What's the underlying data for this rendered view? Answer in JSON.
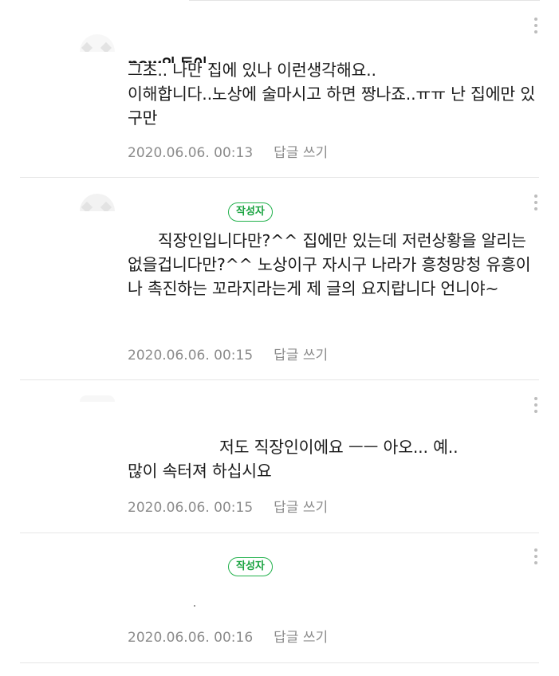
{
  "comments": [
    {
      "author_partial": "new의 동이",
      "text": "그초.. 나만 집에 있나 이런생각해요..\n이해합니다..노상에 술마시고 하면 짱나죠..ㅠㅠ 난 집에만 있구만",
      "date": "2020.06.06. 00:13",
      "reply_label": "답글 쓰기"
    },
    {
      "author_partial": "",
      "badge": "작성자",
      "text": "      직장인입니다만?^^ 집에만 있는데 저런상황을 알리는 없을겁니다만?^^ 노상이구 자시구 나라가 흥청망청 유흥이나 촉진하는 꼬라지라는게 제 글의 요지랍니다 언니야~",
      "date": "2020.06.06. 00:15",
      "reply_label": "답글 쓰기"
    },
    {
      "text": "저도 직장인이에요 ㅡㅡ 아오... 예..\n많이 속터져 하십시요",
      "date": "2020.06.06. 00:15",
      "reply_label": "답글 쓰기"
    },
    {
      "badge": "작성자",
      "text": "",
      "date": "2020.06.06. 00:16",
      "reply_label": "답글 쓰기"
    }
  ],
  "icons": {
    "more": "more-vertical-icon",
    "avatar": "avatar-icon"
  },
  "colors": {
    "badge_green": "#22b14c",
    "meta_gray": "#8b8b8b",
    "divider": "#e6e6e6"
  }
}
